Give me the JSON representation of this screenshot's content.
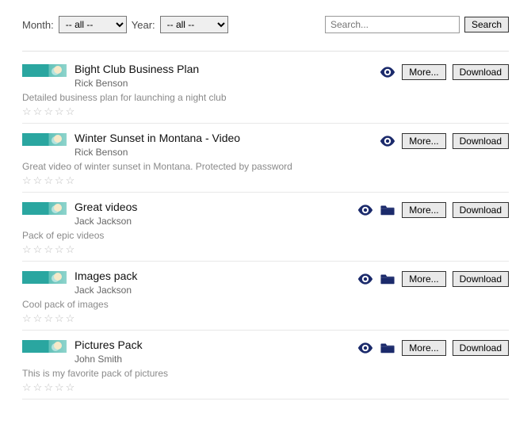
{
  "filters": {
    "month_label": "Month:",
    "month_selected": "-- all --",
    "year_label": "Year:",
    "year_selected": "-- all --"
  },
  "search": {
    "placeholder": "Search...",
    "button_label": "Search"
  },
  "buttons": {
    "more": "More...",
    "download": "Download"
  },
  "items": [
    {
      "title": "Bight Club Business Plan",
      "author": "Rick Benson",
      "description": "Detailed business plan for launching a night club",
      "has_folder": false,
      "rating": 0
    },
    {
      "title": "Winter Sunset in Montana - Video",
      "author": "Rick Benson",
      "description": "Great video of winter sunset in Montana. Protected by password",
      "has_folder": false,
      "rating": 0
    },
    {
      "title": "Great videos",
      "author": "Jack Jackson",
      "description": "Pack of epic videos",
      "has_folder": true,
      "rating": 0
    },
    {
      "title": "Images pack",
      "author": "Jack Jackson",
      "description": "Cool pack of images",
      "has_folder": true,
      "rating": 0
    },
    {
      "title": "Pictures Pack",
      "author": "John Smith",
      "description": "This is my favorite pack of pictures",
      "has_folder": true,
      "rating": 0
    }
  ]
}
